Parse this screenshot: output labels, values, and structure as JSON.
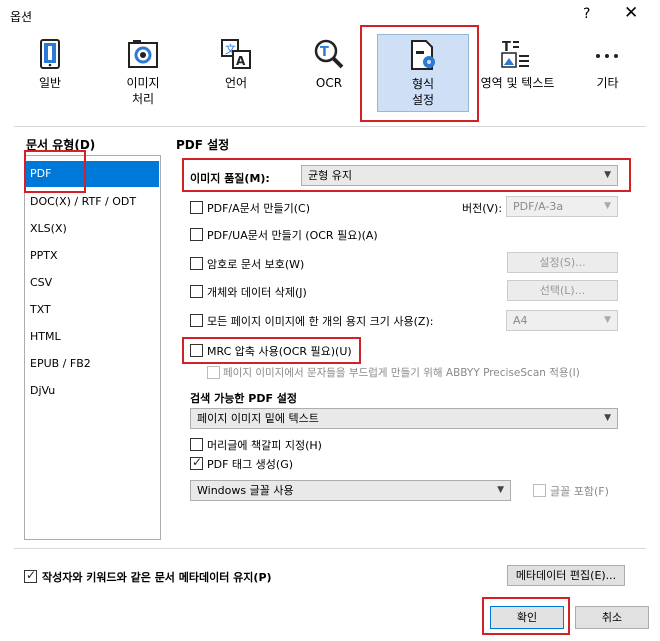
{
  "window": {
    "title": "옵션",
    "help": "?",
    "close": "✕"
  },
  "tabs": [
    {
      "id": "general",
      "label": "일반",
      "icon": "phone-settings-icon"
    },
    {
      "id": "image",
      "label": "이미지\n처리",
      "icon": "camera-icon"
    },
    {
      "id": "language",
      "label": "언어",
      "icon": "translate-icon"
    },
    {
      "id": "ocr",
      "label": "OCR",
      "icon": "ocr-magnifier-icon"
    },
    {
      "id": "format",
      "label": "형식\n설정",
      "icon": "document-gear-icon",
      "selected": true
    },
    {
      "id": "area",
      "label": "영역 및 텍스트",
      "icon": "text-image-icon"
    },
    {
      "id": "other",
      "label": "기타",
      "icon": "more-dots-icon"
    }
  ],
  "doctype": {
    "title": "문서 유형(D)",
    "items": [
      "PDF",
      "DOC(X) / RTF / ODT",
      "XLS(X)",
      "PPTX",
      "CSV",
      "TXT",
      "HTML",
      "EPUB / FB2",
      "DjVu"
    ],
    "selected": "PDF"
  },
  "pdf": {
    "title": "PDF 설정",
    "image_quality_label": "이미지 품질(M):",
    "image_quality_value": "균형 유지",
    "pdfa_label": "PDF/A문서 만들기(C)",
    "version_label": "버전(V):",
    "version_value": "PDF/A-3a",
    "pdfua_label": "PDF/UA문서 만들기 (OCR 필요)(A)",
    "password_label": "암호로 문서 보호(W)",
    "password_btn": "설정(S)...",
    "delete_label": "개체와 데이터 삭제(J)",
    "delete_btn": "선택(L)...",
    "pagesize_label": "모든 페이지 이미지에 한 개의 용지 크기 사용(Z):",
    "pagesize_value": "A4",
    "mrc_label": "MRC 압축 사용(OCR 필요)(U)",
    "precise_label": "페이지 이미지에서 문자들을 부드럽게 만들기 위해 ABBYY PreciseScan 적용(I)",
    "searchable_title": "검색 가능한 PDF 설정",
    "searchable_value": "페이지 이미지 밑에 텍스트",
    "bookmarks_label": "머리글에 책갈피 지정(H)",
    "tags_label": "PDF 태그 생성(G)",
    "font_value": "Windows 글꼴 사용",
    "embed_label": "글꼴 포함(F)"
  },
  "footer": {
    "metadata_label": "작성자와 키워드와 같은 문서 메타데이터 유지(P)",
    "metadata_btn": "메타데이터 편집(E)...",
    "ok": "확인",
    "cancel": "취소"
  }
}
